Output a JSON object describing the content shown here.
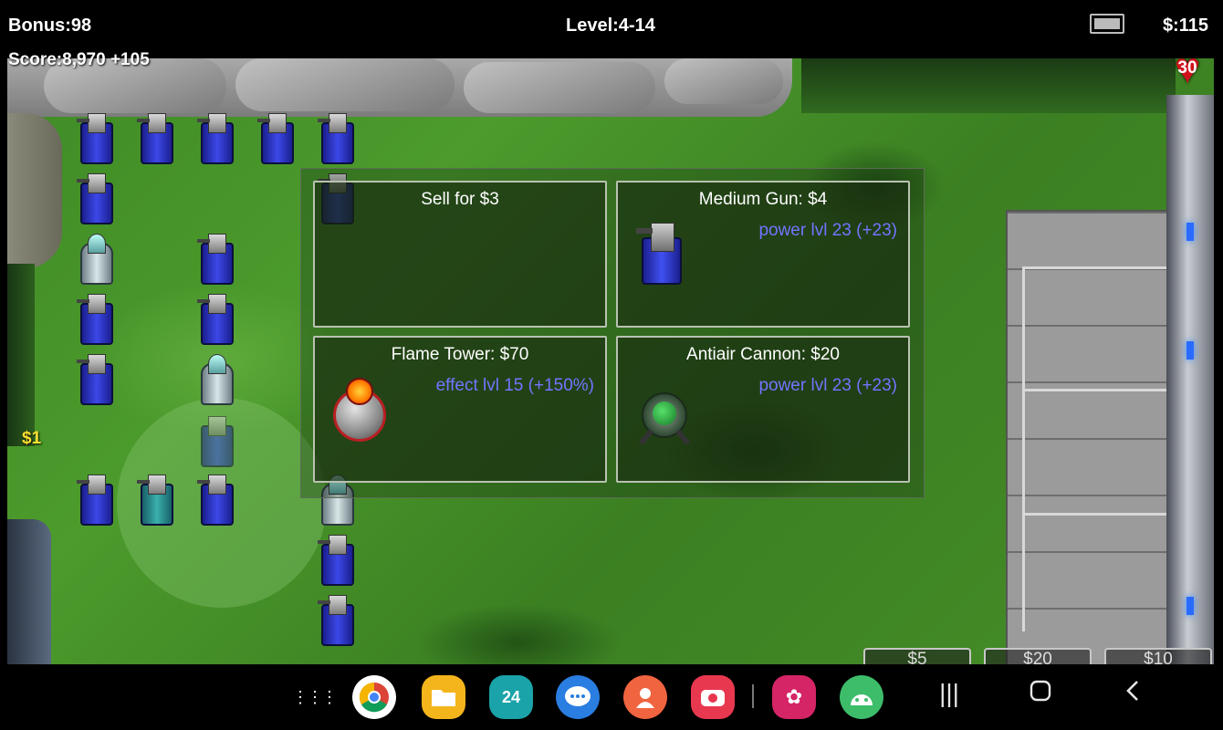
{
  "hud": {
    "bonus": "Bonus:98",
    "level": "Level:4-14",
    "money": "$:115",
    "score": "Score:8,970 +105",
    "lives": "30",
    "floating_reward": "$1"
  },
  "upgrade_panel": {
    "sell": {
      "title": "Sell for $3"
    },
    "medium_gun": {
      "title": "Medium Gun: $4",
      "sub": "power lvl 23 (+23)"
    },
    "flame_tower": {
      "title": "Flame Tower: $70",
      "sub": "effect lvl 15 (+150%)"
    },
    "antiair_cannon": {
      "title": "Antiair Cannon: $20",
      "sub": "power lvl 23 (+23)"
    }
  },
  "price_buttons": [
    "$5",
    "$20",
    "$10"
  ],
  "dock_apps": [
    {
      "name": "apps-grid-icon",
      "glyph": "⋮⋮⋮"
    },
    {
      "name": "chrome-icon",
      "glyph": "◉",
      "color": "#ffffff"
    },
    {
      "name": "files-icon",
      "glyph": "▬",
      "color": "#f3b51b"
    },
    {
      "name": "calendar-icon",
      "glyph": "24",
      "color": "#1aa3a8"
    },
    {
      "name": "messages-icon",
      "glyph": "…",
      "color": "#2a7de1"
    },
    {
      "name": "contacts-icon",
      "glyph": "●",
      "color": "#f06440"
    },
    {
      "name": "camera-icon",
      "glyph": "◙",
      "color": "#e8384f"
    },
    {
      "name": "gallery-icon",
      "glyph": "✿",
      "color": "#d52566"
    },
    {
      "name": "android-icon",
      "glyph": "▲",
      "color": "#3dbd6a"
    }
  ],
  "colors": {
    "grass": "#4c9b2c",
    "upgrade_sub": "#6f76ff",
    "reward": "#ffe030",
    "heart": "#d0121b"
  }
}
